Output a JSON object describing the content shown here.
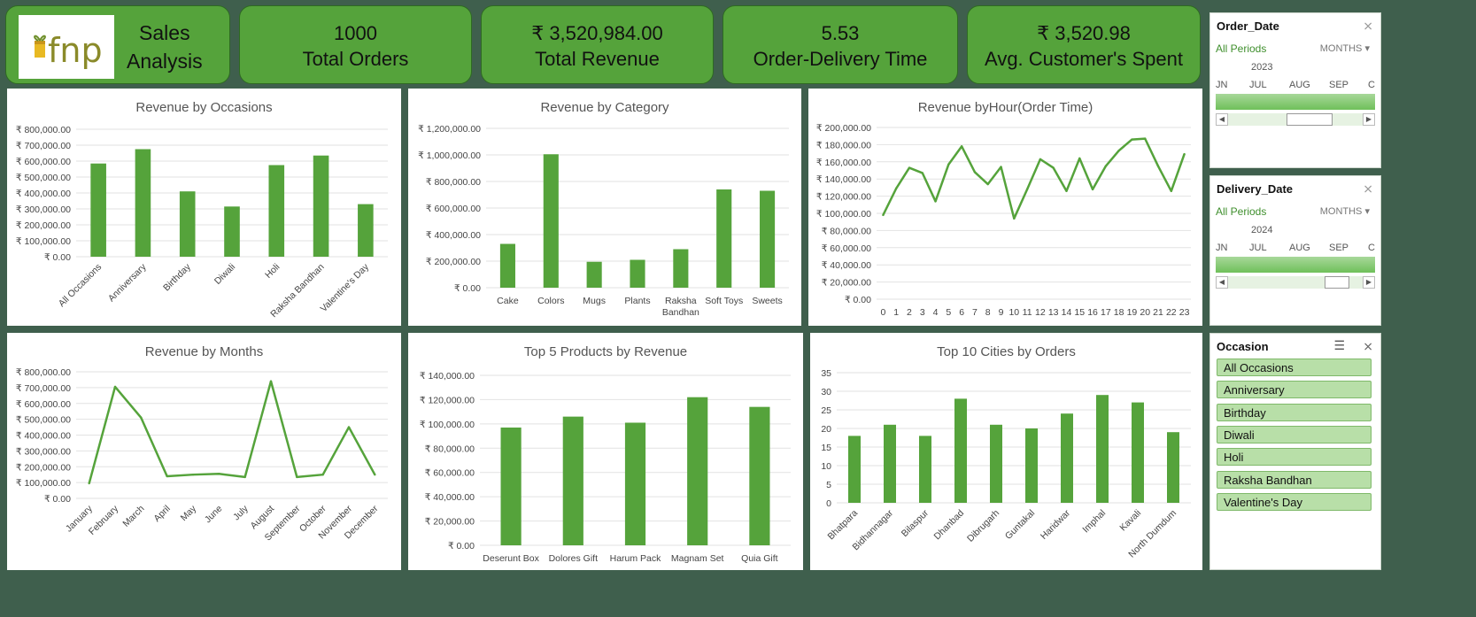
{
  "brand": {
    "logo_text": "fnp",
    "title_line1": "Sales",
    "title_line2": "Analysis"
  },
  "kpis": [
    {
      "value": "1000",
      "label": "Total Orders"
    },
    {
      "value": "₹ 3,520,984.00",
      "label": "Total Revenue"
    },
    {
      "value": "5.53",
      "label": "Order-Delivery Time"
    },
    {
      "value": "₹ 3,520.98",
      "label": "Avg. Customer's Spent"
    }
  ],
  "colors": {
    "accent": "#55a33b",
    "background": "#3f5f4d",
    "bar": "#55a33b"
  },
  "slicers": {
    "order_date": {
      "title": "Order_Date",
      "all": "All Periods",
      "unit": "MONTHS",
      "year": "2023",
      "months": [
        "JN",
        "JUL",
        "AUG",
        "SEP",
        "C"
      ]
    },
    "delivery_date": {
      "title": "Delivery_Date",
      "all": "All Periods",
      "unit": "MONTHS",
      "year": "2024",
      "months": [
        "JN",
        "JUL",
        "AUG",
        "SEP",
        "C"
      ]
    },
    "occasion": {
      "title": "Occasion",
      "items": [
        "All Occasions",
        "Anniversary",
        "Birthday",
        "Diwali",
        "Holi",
        "Raksha Bandhan",
        "Valentine's Day"
      ]
    }
  },
  "chart_data": [
    {
      "type": "bar",
      "title": "Revenue by Occasions",
      "categories": [
        "All Occasions",
        "Anniversary",
        "Birthday",
        "Diwali",
        "Holi",
        "Raksha Bandhan",
        "Valentine's Day"
      ],
      "values": [
        585000,
        675000,
        410000,
        315000,
        575000,
        635000,
        330000
      ],
      "ylim": [
        0,
        800000
      ],
      "yticks": [
        "₹ 0.00",
        "₹ 100,000.00",
        "₹ 200,000.00",
        "₹ 300,000.00",
        "₹ 400,000.00",
        "₹ 500,000.00",
        "₹ 600,000.00",
        "₹ 700,000.00",
        "₹ 800,000.00"
      ],
      "grid": true
    },
    {
      "type": "bar",
      "title": "Revenue by Category",
      "categories": [
        "Cake",
        "Colors",
        "Mugs",
        "Plants",
        "Raksha Bandhan",
        "Soft Toys",
        "Sweets"
      ],
      "values": [
        330000,
        1005000,
        195000,
        210000,
        290000,
        740000,
        730000
      ],
      "ylim": [
        0,
        1200000
      ],
      "yticks": [
        "₹ 0.00",
        "₹ 200,000.00",
        "₹ 400,000.00",
        "₹ 600,000.00",
        "₹ 800,000.00",
        "₹ 1,000,000.00",
        "₹ 1,200,000.00"
      ],
      "grid": true
    },
    {
      "type": "line",
      "title": "Revenue byHour(Order Time)",
      "categories": [
        "0",
        "1",
        "2",
        "3",
        "4",
        "5",
        "6",
        "7",
        "8",
        "9",
        "10",
        "11",
        "12",
        "13",
        "14",
        "15",
        "16",
        "17",
        "18",
        "19",
        "20",
        "21",
        "22",
        "23"
      ],
      "values": [
        98000,
        129000,
        153000,
        147000,
        114000,
        157000,
        178000,
        148000,
        134000,
        154000,
        94000,
        128000,
        163000,
        153000,
        126000,
        164000,
        128000,
        155000,
        173000,
        186000,
        187000,
        155000,
        126000,
        169000
      ],
      "ylim": [
        0,
        200000
      ],
      "yticks": [
        "₹ 0.00",
        "₹ 20,000.00",
        "₹ 40,000.00",
        "₹ 60,000.00",
        "₹ 80,000.00",
        "₹ 100,000.00",
        "₹ 120,000.00",
        "₹ 140,000.00",
        "₹ 160,000.00",
        "₹ 180,000.00",
        "₹ 200,000.00"
      ],
      "grid": true
    },
    {
      "type": "line",
      "title": "Revenue by Months",
      "categories": [
        "January",
        "February",
        "March",
        "April",
        "May",
        "June",
        "July",
        "August",
        "September",
        "October",
        "November",
        "December"
      ],
      "values": [
        95000,
        705000,
        510000,
        140000,
        150000,
        155000,
        135000,
        740000,
        135000,
        150000,
        450000,
        150000
      ],
      "ylim": [
        0,
        800000
      ],
      "yticks": [
        "₹ 0.00",
        "₹ 100,000.00",
        "₹ 200,000.00",
        "₹ 300,000.00",
        "₹ 400,000.00",
        "₹ 500,000.00",
        "₹ 600,000.00",
        "₹ 700,000.00",
        "₹ 800,000.00"
      ],
      "grid": true
    },
    {
      "type": "bar",
      "title": "Top 5 Products by Revenue",
      "categories": [
        "Deserunt Box",
        "Dolores Gift",
        "Harum Pack",
        "Magnam Set",
        "Quia Gift"
      ],
      "values": [
        97000,
        106000,
        101000,
        122000,
        114000
      ],
      "ylim": [
        0,
        140000
      ],
      "yticks": [
        "₹ 0.00",
        "₹ 20,000.00",
        "₹ 40,000.00",
        "₹ 60,000.00",
        "₹ 80,000.00",
        "₹ 100,000.00",
        "₹ 120,000.00",
        "₹ 140,000.00"
      ],
      "grid": true
    },
    {
      "type": "bar",
      "title": "Top 10 Cities by Orders",
      "categories": [
        "Bhatpara",
        "Bidhannagar",
        "Bilaspur",
        "Dhanbad",
        "Dibrugarh",
        "Guntakal",
        "Haridwar",
        "Imphal",
        "Kavali",
        "North Dumdum"
      ],
      "values": [
        18,
        21,
        18,
        28,
        21,
        20,
        24,
        29,
        27,
        19
      ],
      "ylim": [
        0,
        35
      ],
      "yticks": [
        "0",
        "5",
        "10",
        "15",
        "20",
        "25",
        "30",
        "35"
      ],
      "grid": true
    }
  ]
}
